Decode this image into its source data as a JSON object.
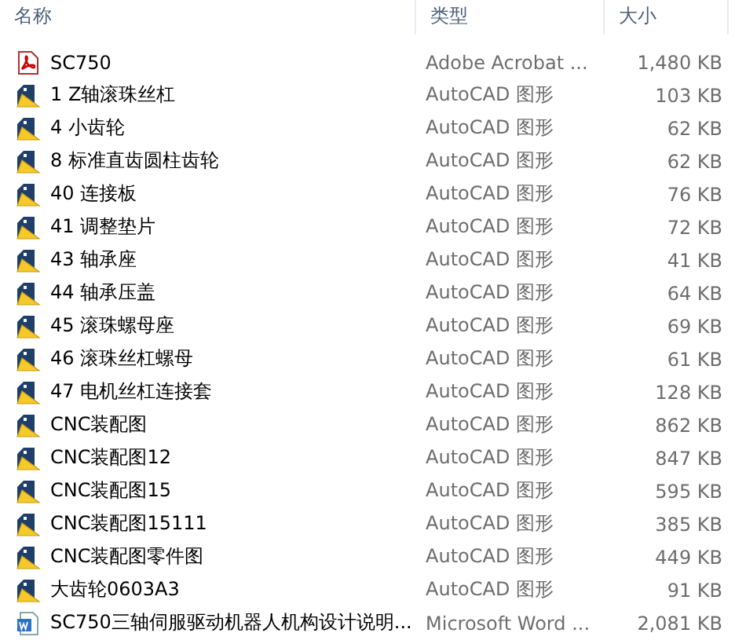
{
  "columns": [
    "名称",
    "类型",
    "大小"
  ],
  "files": [
    {
      "name": "SC750",
      "type": "Adobe Acrobat ...",
      "size": "1,480 KB",
      "kind": "pdf"
    },
    {
      "name": "1 Z轴滚珠丝杠",
      "type": "AutoCAD 图形",
      "size": "103 KB",
      "kind": "dwg"
    },
    {
      "name": "4 小齿轮",
      "type": "AutoCAD 图形",
      "size": "62 KB",
      "kind": "dwg"
    },
    {
      "name": "8 标准直齿圆柱齿轮",
      "type": "AutoCAD 图形",
      "size": "62 KB",
      "kind": "dwg"
    },
    {
      "name": "40 连接板",
      "type": "AutoCAD 图形",
      "size": "76 KB",
      "kind": "dwg"
    },
    {
      "name": "41 调整垫片",
      "type": "AutoCAD 图形",
      "size": "72 KB",
      "kind": "dwg"
    },
    {
      "name": "43 轴承座",
      "type": "AutoCAD 图形",
      "size": "41 KB",
      "kind": "dwg"
    },
    {
      "name": "44 轴承压盖",
      "type": "AutoCAD 图形",
      "size": "64 KB",
      "kind": "dwg"
    },
    {
      "name": "45 滚珠螺母座",
      "type": "AutoCAD 图形",
      "size": "69 KB",
      "kind": "dwg"
    },
    {
      "name": "46 滚珠丝杠螺母",
      "type": "AutoCAD 图形",
      "size": "61 KB",
      "kind": "dwg"
    },
    {
      "name": "47 电机丝杠连接套",
      "type": "AutoCAD 图形",
      "size": "128 KB",
      "kind": "dwg"
    },
    {
      "name": "CNC装配图",
      "type": "AutoCAD 图形",
      "size": "862 KB",
      "kind": "dwg"
    },
    {
      "name": "CNC装配图12",
      "type": "AutoCAD 图形",
      "size": "847 KB",
      "kind": "dwg"
    },
    {
      "name": "CNC装配图15",
      "type": "AutoCAD 图形",
      "size": "595 KB",
      "kind": "dwg"
    },
    {
      "name": "CNC装配图15111",
      "type": "AutoCAD 图形",
      "size": "385 KB",
      "kind": "dwg"
    },
    {
      "name": "CNC装配图零件图",
      "type": "AutoCAD 图形",
      "size": "449 KB",
      "kind": "dwg"
    },
    {
      "name": "大齿轮0603A3",
      "type": "AutoCAD 图形",
      "size": "91 KB",
      "kind": "dwg"
    },
    {
      "name": "SC750三轴伺服驱动机器人机构设计说明...",
      "type": "Microsoft Word ...",
      "size": "2,081 KB",
      "kind": "doc"
    }
  ]
}
